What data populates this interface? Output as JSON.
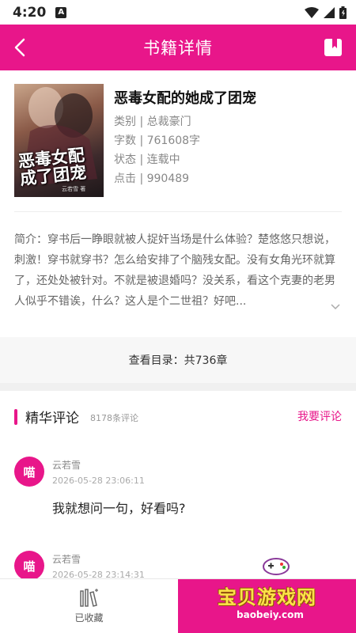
{
  "status": {
    "time": "4:20",
    "app_glyph": "A"
  },
  "header": {
    "title": "书籍详情"
  },
  "book": {
    "title": "恶毒女配的她成了团宠",
    "cover_title": "恶毒女配成了团宠",
    "cover_author": "云若雪 著",
    "category": "类别 | 总裁豪门",
    "words": "字数 | 761608字",
    "state": "状态 | 连载中",
    "clicks": "点击 | 990489"
  },
  "intro": "简介：穿书后一睁眼就被人捉奸当场是什么体验？楚悠悠只想说，刺激！穿书就穿书？怎么给安排了个脑残女配。没有女角光环就算了，还处处被针对。不就是被退婚吗？没关系，看这个克妻的老男人似乎不错诶，什么？这人是个二世祖？好吧...",
  "catalog": {
    "label": "查看目录：共736章"
  },
  "reviews": {
    "title": "精华评论",
    "count": "8178条评论",
    "write": "我要评论",
    "items": [
      {
        "avatar": "喵",
        "user": "云若雪",
        "time": "2026-05-28 23:06:11",
        "text": "我就想问一句，好看吗?"
      },
      {
        "avatar": "喵",
        "user": "云若雪",
        "time": "2026-05-28 23:14:31",
        "text": ""
      }
    ]
  },
  "bottom": {
    "collect_label": "已收藏"
  },
  "watermark": {
    "title": "宝贝游戏网",
    "url": "baobeiy.com"
  },
  "colors": {
    "accent": "#e8168a"
  }
}
